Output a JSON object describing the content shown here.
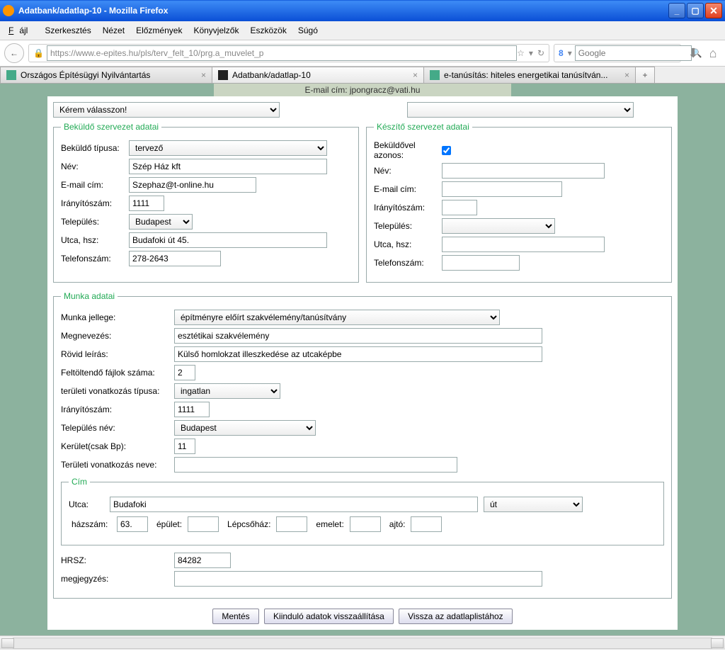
{
  "window": {
    "title": "Adatbank/adatlap-10 - Mozilla Firefox"
  },
  "menu": {
    "file": "Fájl",
    "edit": "Szerkesztés",
    "view": "Nézet",
    "history": "Előzmények",
    "bookmarks": "Könyvjelzők",
    "tools": "Eszközök",
    "help": "Súgó"
  },
  "url": {
    "value": "https://www.e-epites.hu/pls/terv_felt_10/prg.a_muvelet_p"
  },
  "search": {
    "placeholder": "Google"
  },
  "tabs": {
    "t1": "Országos Építésügyi Nyilvántartás",
    "t2": "Adatbank/adatlap-10",
    "t3": "e-tanúsítás: hiteles energetikai tanúsítván..."
  },
  "email_strip": "E-mail cím: jpongracz@vati.hu",
  "topselect": {
    "left": "Kérem válasszon!",
    "right": ""
  },
  "legends": {
    "bekuldo": "Beküldő szervezet adatai",
    "keszito": "Készítő szervezet adatai",
    "munka": "Munka adatai",
    "cim": "Cím"
  },
  "labels": {
    "bekuldo_tipus": "Beküldő típusa:",
    "nev": "Név:",
    "email": "E-mail cím:",
    "irsz": "Irányítószám:",
    "telepules": "Település:",
    "utca_hsz": "Utca, hsz:",
    "telefon": "Telefonszám:",
    "bekuldovel": "Beküldővel azonos:",
    "munka_jellege": "Munka jellege:",
    "megnevezes": "Megnevezés:",
    "rovid_leiras": "Rövid leírás:",
    "feltoltendo": "Feltöltendő fájlok száma:",
    "teruleti_tipus": "területi vonatkozás típusa:",
    "telepules_nev": "Település név:",
    "kerulet": "Kerület(csak Bp):",
    "teruleti_nev": "Területi vonatkozás neve:",
    "utca": "Utca:",
    "hazszam": "házszám:",
    "epulet": "épület:",
    "lepcsohaz": "Lépcsőház:",
    "emelet": "emelet:",
    "ajto": "ajtó:",
    "hrsz": "HRSZ:",
    "megjegyzes": "megjegyzés:"
  },
  "values": {
    "bekuldo_tipus": "tervező",
    "nev": "Szép Ház kft",
    "email": "Szephaz@t-online.hu",
    "irsz": "1111",
    "telepules": "Budapest",
    "utca_hsz": "Budafoki út 45.",
    "telefon": "278-2643",
    "munka_jellege": "építményre előírt szakvélemény/tanúsítvány",
    "megnevezes": "esztétikai szakvélemény",
    "rovid_leiras": "Külső homlokzat illeszkedése az utcaképbe",
    "feltoltendo": "2",
    "teruleti_tipus": "ingatlan",
    "munka_irsz": "1111",
    "telepules_nev": "Budapest",
    "kerulet": "11",
    "teruleti_nev": "",
    "utca_street": "Budafoki",
    "utca_type": "út",
    "hazszam": "63.",
    "hrsz": "84282"
  },
  "buttons": {
    "save": "Mentés",
    "reset": "Kiinduló adatok visszaállítása",
    "back": "Vissza az adatlaplistához"
  }
}
